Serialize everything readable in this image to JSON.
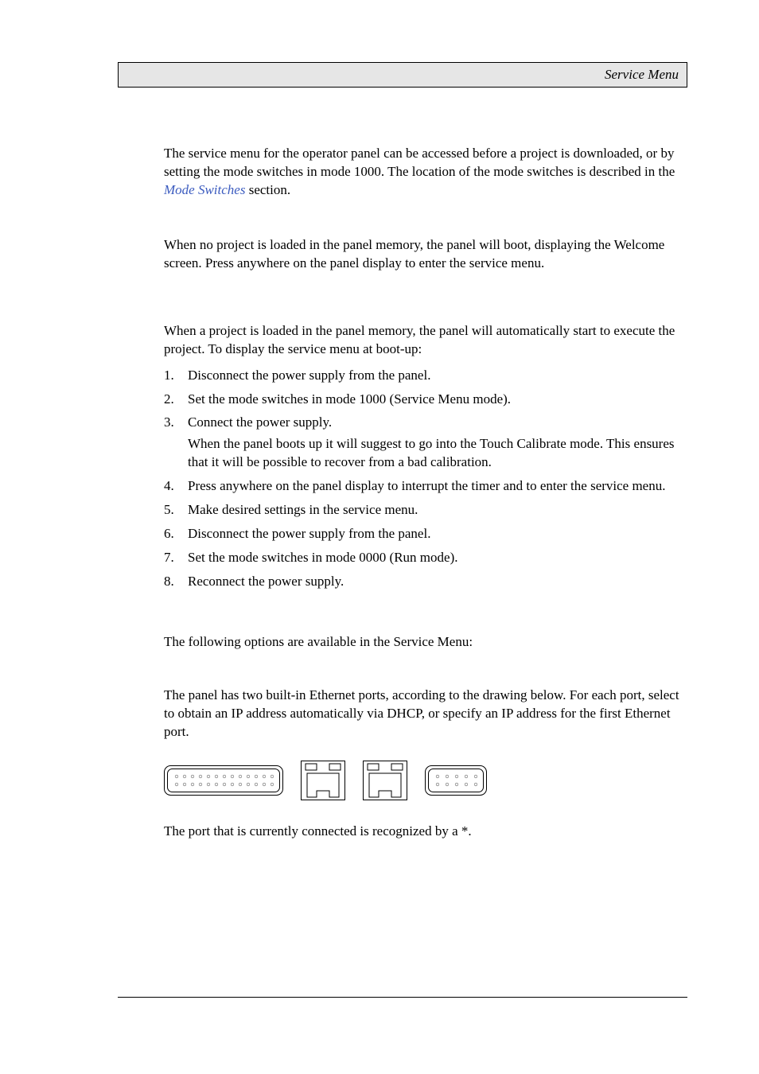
{
  "header": {
    "title": "Service Menu"
  },
  "intro": {
    "text_before_link": "The service menu for the operator panel can be accessed before a project is downloaded, or by setting the mode switches in mode 1000. The location of the mode switches is described in the ",
    "link_text": "Mode Switches",
    "text_after_link": " section."
  },
  "sec_no_project": {
    "para": "When no project is loaded in the panel memory, the panel will boot, displaying the Welcome screen. Press anywhere on the panel display to enter the service menu."
  },
  "sec_with_project": {
    "para": "When a project is loaded in the panel memory, the panel will automatically start to execute the project. To display the service menu at boot-up:",
    "steps": [
      {
        "num": "1.",
        "text": "Disconnect the power supply from the panel."
      },
      {
        "num": "2.",
        "text": "Set the mode switches in mode 1000 (Service Menu mode)."
      },
      {
        "num": "3.",
        "text": "Connect the power supply.",
        "sub": "When the panel boots up it will suggest to go into the Touch Calibrate mode. This ensures that it will be possible to recover from a bad calibration."
      },
      {
        "num": "4.",
        "text": "Press anywhere on the panel display to interrupt the timer and to enter the service menu."
      },
      {
        "num": "5.",
        "text": "Make desired settings in the service menu."
      },
      {
        "num": "6.",
        "text": "Disconnect the power supply from the panel."
      },
      {
        "num": "7.",
        "text": "Set the mode switches in mode 0000 (Run mode)."
      },
      {
        "num": "8.",
        "text": "Reconnect the power supply."
      }
    ]
  },
  "sec_options": {
    "intro": "The following options are available in the Service Menu:"
  },
  "sec_ethernet": {
    "para": "The panel has two built-in Ethernet ports, according to the drawing below. For each port, select to obtain an IP address automatically via DHCP, or specify an IP address for the first Ethernet port.",
    "footer": "The port that is currently connected is recognized by a *."
  }
}
